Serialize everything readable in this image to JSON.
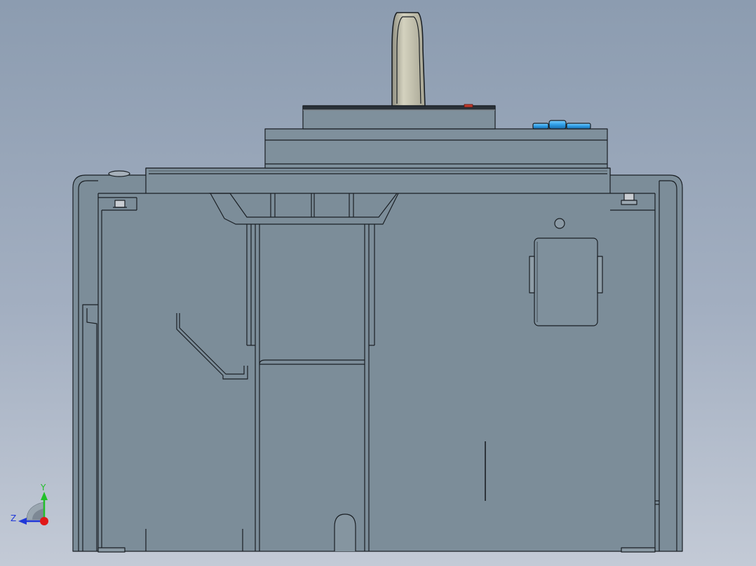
{
  "viewport": {
    "background_top": "#8c9cb0",
    "background_bottom": "#c3cad6"
  },
  "model": {
    "body_color": "#7c8d99",
    "edge_color": "#1a1f24",
    "handle_color": "#c2c0ac",
    "button_color": "#2e9ee6",
    "indicator_color": "#c0392b"
  },
  "triad": {
    "y_label": "Y",
    "z_label": "Z",
    "y_color": "#22c02a",
    "z_color": "#2038d8",
    "x_color": "#e01818"
  }
}
